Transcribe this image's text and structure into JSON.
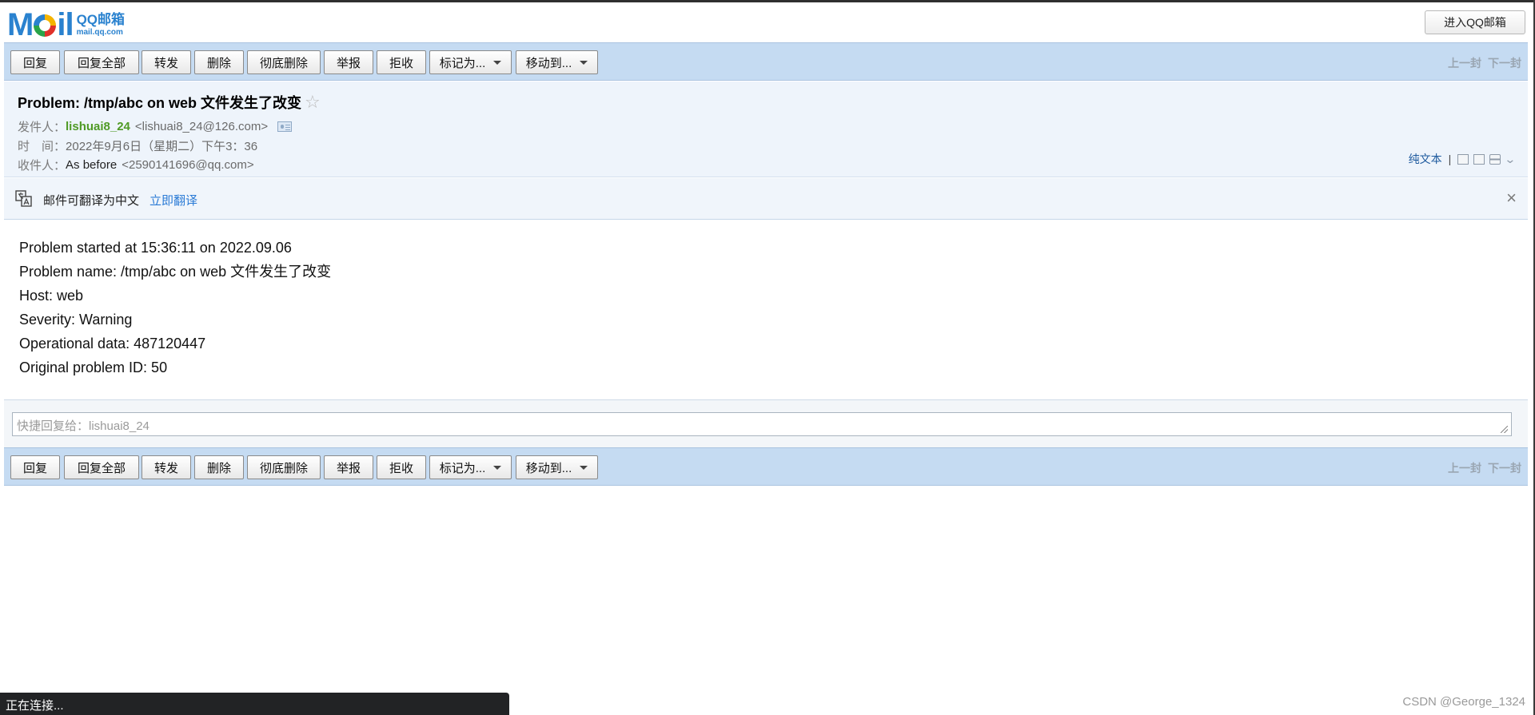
{
  "header": {
    "logo_word_left": "M",
    "logo_word_right": "il",
    "logo_line1": "QQ邮箱",
    "logo_line2": "mail.qq.com",
    "enter_button": "进入QQ邮箱"
  },
  "toolbar": {
    "buttons": [
      "回复",
      "回复全部",
      "转发",
      "删除",
      "彻底删除",
      "举报",
      "拒收",
      "标记为...",
      "移动到..."
    ],
    "prev": "上一封",
    "next": "下一封"
  },
  "mail": {
    "subject": "Problem: /tmp/abc on web 文件发生了改变",
    "from_label": "发件人：",
    "from_name": "lishuai8_24",
    "from_addr": "<lishuai8_24@126.com>",
    "time_label": "时　间：",
    "time_value": "2022年9月6日（星期二）下午3：36",
    "to_label": "收件人：",
    "to_name": "As before",
    "to_addr": "<2590141696@qq.com>",
    "plain_text": "纯文本",
    "separator": "|"
  },
  "translate": {
    "text": "邮件可翻译为中文",
    "link": "立即翻译"
  },
  "body_lines": [
    "Problem started at 15:36:11 on 2022.09.06",
    "Problem name: /tmp/abc on web 文件发生了改变",
    "Host: web",
    "Severity: Warning",
    "Operational data: 487120447",
    "Original problem ID: 50"
  ],
  "quick_reply": {
    "placeholder": "快捷回复给：lishuai8_24"
  },
  "status": {
    "text": "正在连接..."
  },
  "watermark": "CSDN @George_1324",
  "colors": {
    "toolbar_bg": "#c5dbf2",
    "header_bg": "#eef4fb",
    "sender_green": "#4f9a25",
    "link_blue": "#2b7bd6"
  },
  "icons": [
    "star-icon",
    "contact-card-icon",
    "translate-icon",
    "close-icon",
    "note-icon",
    "new-window-icon",
    "print-icon",
    "expand-icon",
    "resize-icon",
    "caret-down-icon"
  ]
}
